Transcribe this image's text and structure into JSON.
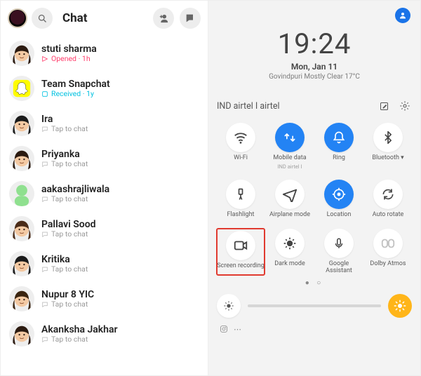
{
  "left": {
    "title": "Chat",
    "items": [
      {
        "name": "stuti sharma",
        "sub": "Opened  ·  1h",
        "icon": "sent-opened",
        "iconColor": "#ff3e6c"
      },
      {
        "name": "Team Snapchat",
        "sub": "Received  ·  1y",
        "icon": "received",
        "iconColor": "#00c1e0"
      },
      {
        "name": "Ira",
        "sub": "Tap to chat",
        "icon": "chat",
        "iconColor": "#bdbdbd"
      },
      {
        "name": "Priyanka",
        "sub": "Tap to chat",
        "icon": "chat",
        "iconColor": "#bdbdbd"
      },
      {
        "name": "aakashrajliwala",
        "sub": "Tap to chat",
        "icon": "chat",
        "iconColor": "#bdbdbd"
      },
      {
        "name": "Pallavi Sood",
        "sub": "Tap to chat",
        "icon": "chat",
        "iconColor": "#bdbdbd"
      },
      {
        "name": "Kritika",
        "sub": "Tap to chat",
        "icon": "chat",
        "iconColor": "#bdbdbd"
      },
      {
        "name": "Nupur 8 YIC",
        "sub": "Tap to chat",
        "icon": "chat",
        "iconColor": "#bdbdbd"
      },
      {
        "name": "Akanksha Jakhar",
        "sub": "Tap to chat",
        "icon": "chat",
        "iconColor": "#bdbdbd"
      }
    ]
  },
  "right": {
    "clock": "19:24",
    "date": "Mon, Jan 11",
    "weather": "Govindpuri Mostly Clear 17°C",
    "carrier": "IND airtel I airtel",
    "tiles": [
      {
        "key": "wifi",
        "label": "Wi-Fi",
        "on": false
      },
      {
        "key": "data",
        "label": "Mobile data",
        "sub": "IND airtel I",
        "on": true
      },
      {
        "key": "ring",
        "label": "Ring",
        "on": true
      },
      {
        "key": "bt",
        "label": "Bluetooth ▾",
        "on": false
      },
      {
        "key": "flash",
        "label": "Flashlight",
        "on": false
      },
      {
        "key": "airplane",
        "label": "Airplane mode",
        "on": false
      },
      {
        "key": "location",
        "label": "Location",
        "on": true
      },
      {
        "key": "rotate",
        "label": "Auto rotate",
        "on": false
      },
      {
        "key": "screenrec",
        "label": "Screen recording",
        "on": false,
        "hl": true
      },
      {
        "key": "dark",
        "label": "Dark mode",
        "on": false
      },
      {
        "key": "assistant",
        "label": "Google Assistant",
        "on": false
      },
      {
        "key": "dolby",
        "label": "Dolby Atmos",
        "dim": true
      }
    ],
    "pager": "●  ○"
  }
}
